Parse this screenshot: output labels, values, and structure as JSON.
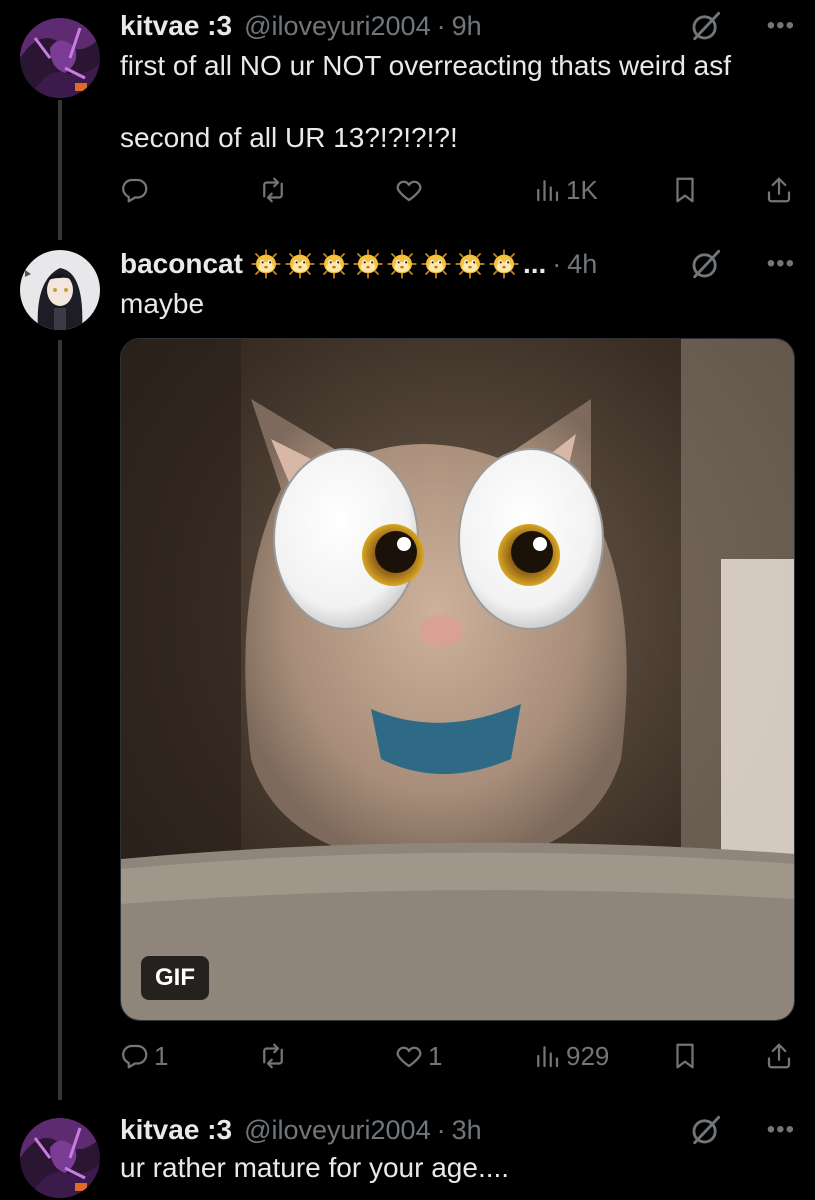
{
  "tweets": [
    {
      "name": "kitvae :3",
      "handle": "@iloveyuri2004",
      "time": "9h",
      "text": "first of all NO ur NOT overreacting thats weird asf\n\nsecond of all UR 13?!?!?!?!",
      "replies": "",
      "likes": "",
      "views": "1K"
    },
    {
      "name": "baconcat",
      "name_suffix": "...",
      "handle": "",
      "time": "4h",
      "text": "maybe",
      "media_badge": "GIF",
      "replies": "1",
      "likes": "1",
      "views": "929"
    },
    {
      "name": "kitvae :3",
      "handle": "@iloveyuri2004",
      "time": "3h",
      "text": "ur rather mature for your age...."
    }
  ],
  "separator": "·",
  "more_glyph": "•••",
  "icons": {
    "reply": "reply-icon",
    "repost": "repost-icon",
    "like": "heart-icon",
    "views": "views-icon",
    "bookmark": "bookmark-icon",
    "share": "share-icon",
    "grok": "grok-icon",
    "more": "more-icon",
    "emoji": "blowfish-emoji"
  },
  "colors": {
    "background": "#000000",
    "text": "#e7e9ea",
    "muted": "#71767b",
    "line": "#333639"
  }
}
